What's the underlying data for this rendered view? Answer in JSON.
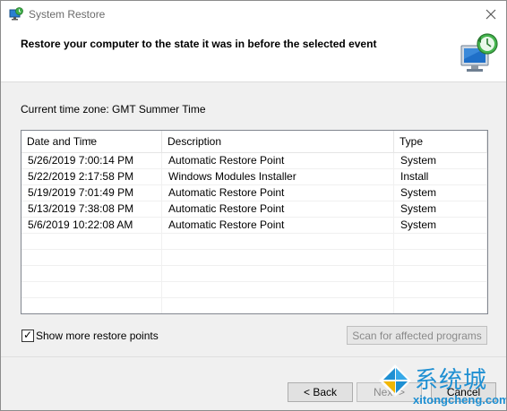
{
  "window": {
    "title": "System Restore",
    "app_icon": "system-restore-icon",
    "close_icon": "close-icon"
  },
  "header": {
    "title": "Restore your computer to the state it was in before the selected event",
    "graphic": "computer-clock-icon"
  },
  "timezone": {
    "label": "Current time zone: GMT Summer Time"
  },
  "table": {
    "columns": [
      "Date and Time",
      "Description",
      "Type"
    ],
    "sort_column": "Date and Time",
    "rows": [
      [
        "5/26/2019 7:00:14 PM",
        "Automatic Restore Point",
        "System"
      ],
      [
        "5/22/2019 2:17:58 PM",
        "Windows Modules Installer",
        "Install"
      ],
      [
        "5/19/2019 7:01:49 PM",
        "Automatic Restore Point",
        "System"
      ],
      [
        "5/13/2019 7:38:08 PM",
        "Automatic Restore Point",
        "System"
      ],
      [
        "5/6/2019 10:22:08 AM",
        "Automatic Restore Point",
        "System"
      ]
    ]
  },
  "options": {
    "show_more_label": "Show more restore points",
    "show_more_checked": true,
    "scan_button": "Scan for affected programs"
  },
  "footer": {
    "back": "< Back",
    "next": "Next >",
    "cancel": "Cancel"
  },
  "watermark": {
    "text": "系统城",
    "url": "xitongcheng.com"
  }
}
